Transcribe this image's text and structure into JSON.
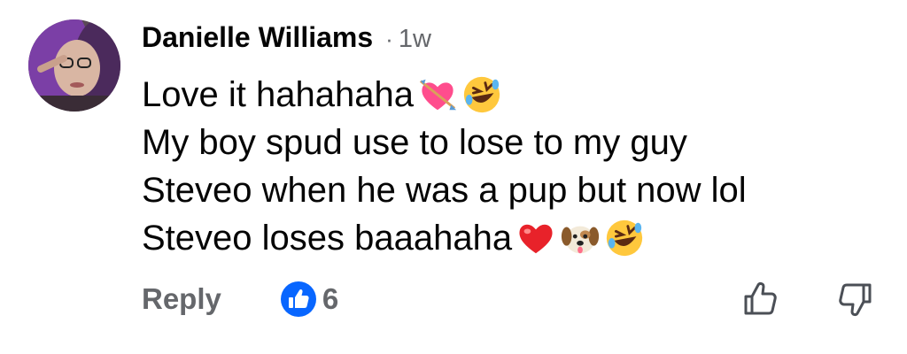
{
  "comment": {
    "author": "Danielle Williams",
    "separator": "·",
    "timestamp": "1w",
    "avatar": "profile-photo",
    "lines": [
      {
        "text": "Love it hahahaha",
        "emojis": [
          "heart-with-arrow-emoji",
          "rolling-on-floor-laughing-emoji"
        ]
      },
      {
        "text": "My boy spud use to lose to my guy",
        "emojis": []
      },
      {
        "text": "Steveo when he was a pup but now lol",
        "emojis": []
      },
      {
        "text": "Steveo loses baaahaha",
        "emojis": [
          "red-heart-emoji",
          "dog-face-emoji",
          "rolling-on-floor-laughing-emoji"
        ]
      }
    ]
  },
  "actions": {
    "reply_label": "Reply",
    "like_count": "6",
    "like_icon": "thumbs-up-reaction-icon",
    "upvote_icon": "thumbs-up-icon",
    "downvote_icon": "thumbs-down-icon"
  },
  "colors": {
    "text_primary": "#050505",
    "text_secondary": "#65676b",
    "like_blue": "#0866ff"
  }
}
